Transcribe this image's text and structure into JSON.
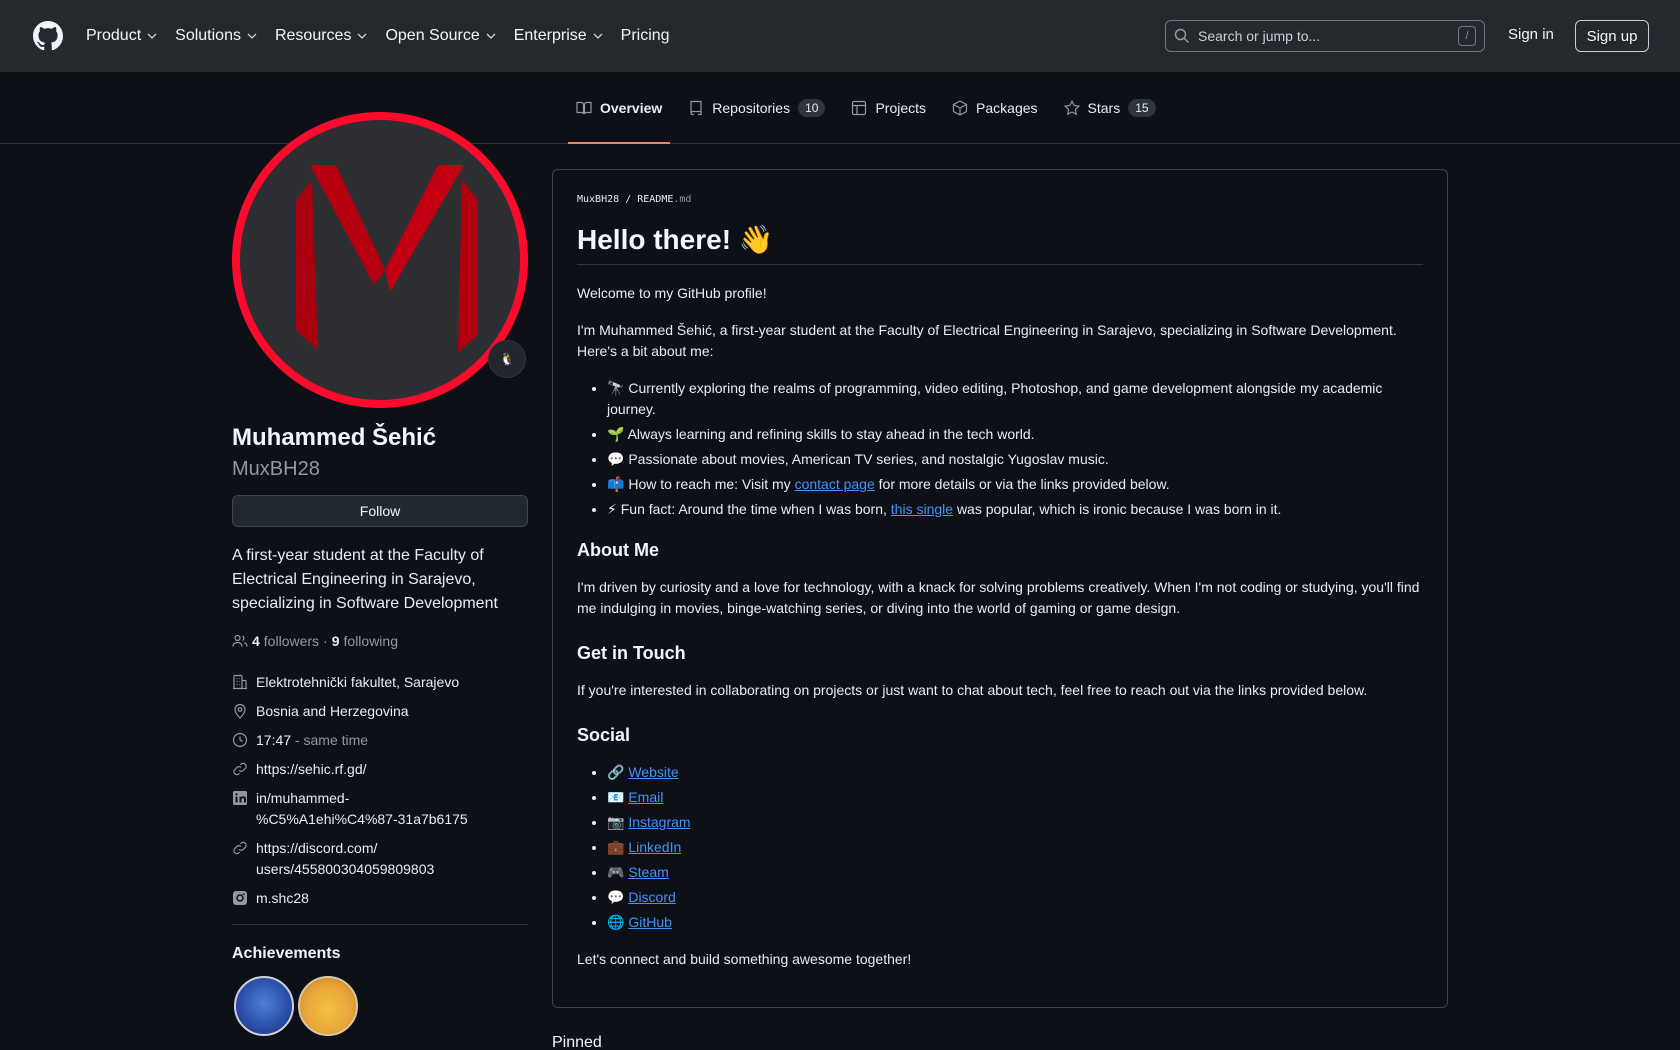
{
  "header": {
    "nav": [
      {
        "label": "Product",
        "dropdown": true
      },
      {
        "label": "Solutions",
        "dropdown": true
      },
      {
        "label": "Resources",
        "dropdown": true
      },
      {
        "label": "Open Source",
        "dropdown": true
      },
      {
        "label": "Enterprise",
        "dropdown": true
      },
      {
        "label": "Pricing",
        "dropdown": false
      }
    ],
    "search_placeholder": "Search or jump to...",
    "search_shortcut": "/",
    "sign_in": "Sign in",
    "sign_up": "Sign up"
  },
  "tabs": [
    {
      "label": "Overview",
      "count": null,
      "active": true,
      "icon": "book-icon"
    },
    {
      "label": "Repositories",
      "count": "10",
      "active": false,
      "icon": "repo-icon"
    },
    {
      "label": "Projects",
      "count": null,
      "active": false,
      "icon": "table-icon"
    },
    {
      "label": "Packages",
      "count": null,
      "active": false,
      "icon": "package-icon"
    },
    {
      "label": "Stars",
      "count": "15",
      "active": false,
      "icon": "star-icon"
    }
  ],
  "profile": {
    "full_name": "Muhammed Šehić",
    "username": "MuxBH28",
    "follow_label": "Follow",
    "bio": "A first-year student at the Faculty of Electrical Engineering in Sarajevo, specializing in Software Development",
    "followers_count": "4",
    "followers_label": "followers",
    "separator": "·",
    "following_count": "9",
    "following_label": "following",
    "status_emoji": "🐧",
    "vcard": {
      "org": "Elektrotehnički fakultet, Sarajevo",
      "location": "Bosnia and Herzegovina",
      "time": "17:47",
      "time_suffix": "- same time",
      "website": "https://sehic.rf.gd/",
      "linkedin_1": "in/muhammed-",
      "linkedin_2": "%C5%A1ehi%C4%87-31a7b6175",
      "discord_1": "https://discord.com/",
      "discord_2": "users/455800304059809803",
      "instagram": "m.shc28"
    },
    "achievements_title": "Achievements"
  },
  "readme": {
    "owner": "MuxBH28",
    "sep": "/",
    "file": "README",
    "ext": ".md",
    "title": "Hello there!",
    "title_emoji": "👋",
    "welcome": "Welcome to my GitHub profile!",
    "intro": "I'm Muhammed Šehić, a first-year student at the Faculty of Electrical Engineering in Sarajevo, specializing in Software Development. Here's a bit about me:",
    "bullets": {
      "b1_emoji": "🔭",
      "b1": "Currently exploring the realms of programming, video editing, Photoshop, and game development alongside my academic journey.",
      "b2_emoji": "🌱",
      "b2": "Always learning and refining skills to stay ahead in the tech world.",
      "b3_emoji": "💬",
      "b3": "Passionate about movies, American TV series, and nostalgic Yugoslav music.",
      "b4_emoji": "📫",
      "b4_pre": "How to reach me: Visit my",
      "b4_link": "contact page",
      "b4_post": "for more details or via the links provided below.",
      "b5_emoji": "⚡",
      "b5_pre": "Fun fact: Around the time when I was born,",
      "b5_link": "this single",
      "b5_post": "was popular, which is ironic because I was born in it."
    },
    "about_title": "About Me",
    "about_text": "I'm driven by curiosity and a love for technology, with a knack for solving problems creatively. When I'm not coding or studying, you'll find me indulging in movies, binge-watching series, or diving into the world of gaming or game design.",
    "contact_title": "Get in Touch",
    "contact_text": "If you're interested in collaborating on projects or just want to chat about tech, feel free to reach out via the links provided below.",
    "social_title": "Social",
    "social": [
      {
        "emoji": "🔗",
        "label": "Website"
      },
      {
        "emoji": "📧",
        "label": "Email"
      },
      {
        "emoji": "📷",
        "label": "Instagram"
      },
      {
        "emoji": "💼",
        "label": "LinkedIn"
      },
      {
        "emoji": "🎮",
        "label": "Steam"
      },
      {
        "emoji": "💬",
        "label": "Discord"
      },
      {
        "emoji": "🌐",
        "label": "GitHub"
      }
    ],
    "closing": "Let's connect and build something awesome together!"
  },
  "pinned_title": "Pinned",
  "colors": {
    "bg": "#0d1117",
    "header_bg": "#25292e",
    "link": "#4493f8",
    "tab_underline": "#f78166",
    "avatar_ring": "#ff0a2c"
  }
}
